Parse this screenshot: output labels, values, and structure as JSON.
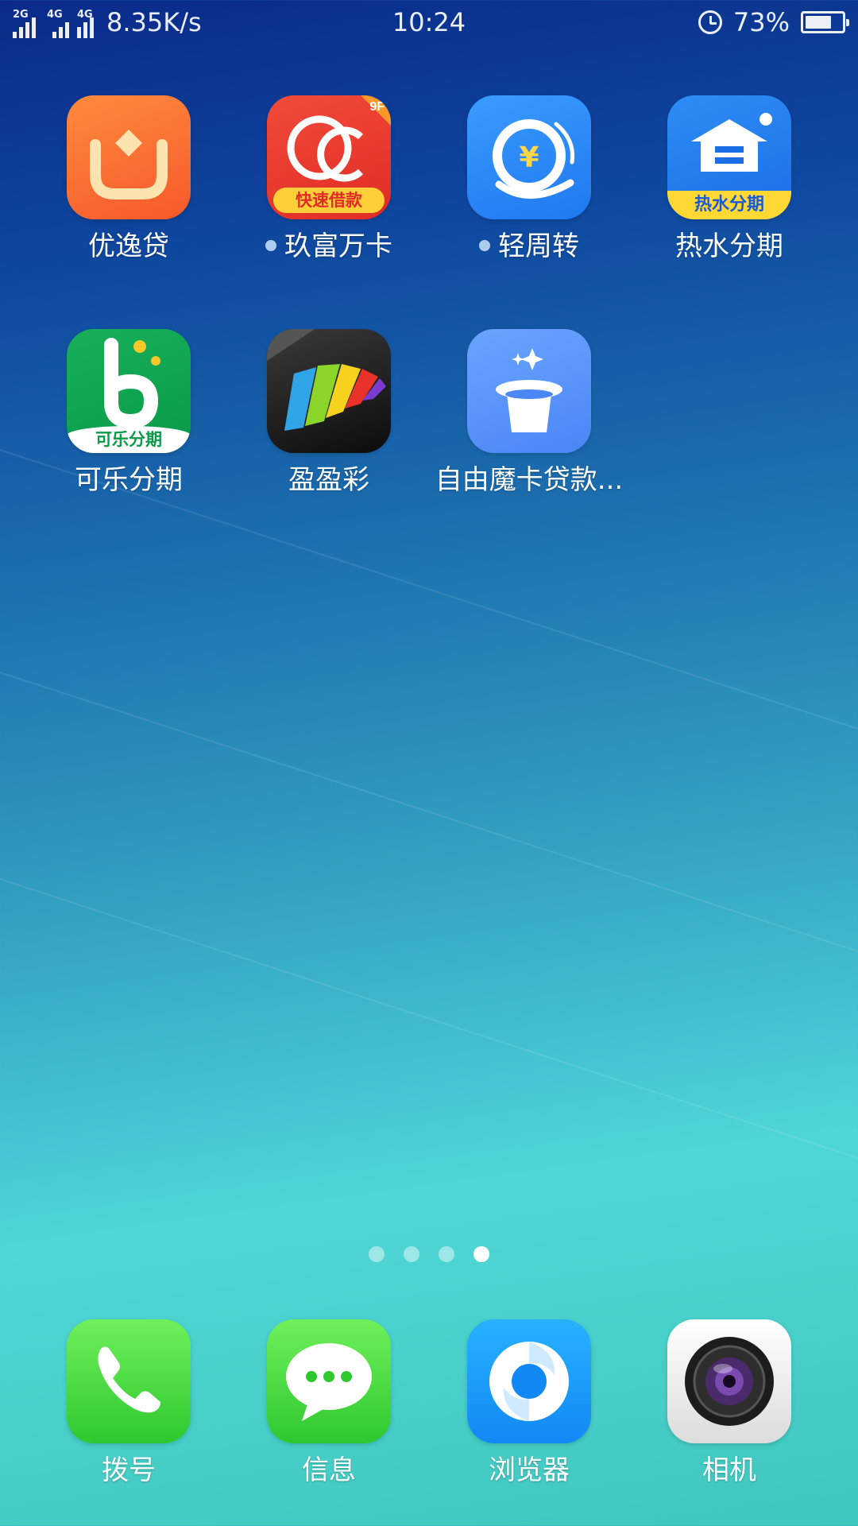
{
  "status_bar": {
    "sim1_label": "2G",
    "sim2_label": "4G",
    "sim3_label": "4G",
    "net_speed": "8.35K/s",
    "time": "10:24",
    "alarm_icon": "alarm-clock-icon",
    "battery_percent": "73%",
    "battery_level": 0.73
  },
  "apps": [
    {
      "label": "优逸贷",
      "icon": "yoyi-loan-icon",
      "has_new_dot": false
    },
    {
      "label": "玖富万卡",
      "icon": "jiufu-wanka-icon",
      "has_new_dot": true,
      "badge_text": "快速借款",
      "corner_text": "9F"
    },
    {
      "label": "轻周转",
      "icon": "qing-zhouzhuan-icon",
      "has_new_dot": true
    },
    {
      "label": "热水分期",
      "icon": "reshui-fenqi-icon",
      "has_new_dot": false,
      "badge_text": "热水分期"
    },
    {
      "label": "可乐分期",
      "icon": "kele-fenqi-icon",
      "has_new_dot": false,
      "badge_text": "可乐分期"
    },
    {
      "label": "盈盈彩",
      "icon": "yingying-cai-icon",
      "has_new_dot": false
    },
    {
      "label": "自由魔卡贷款...",
      "icon": "magic-hat-icon",
      "has_new_dot": false
    }
  ],
  "page_indicator": {
    "count": 4,
    "active": 4
  },
  "dock": [
    {
      "label": "拨号",
      "icon": "phone-icon"
    },
    {
      "label": "信息",
      "icon": "message-icon"
    },
    {
      "label": "浏览器",
      "icon": "browser-icon"
    },
    {
      "label": "相机",
      "icon": "camera-icon"
    }
  ]
}
